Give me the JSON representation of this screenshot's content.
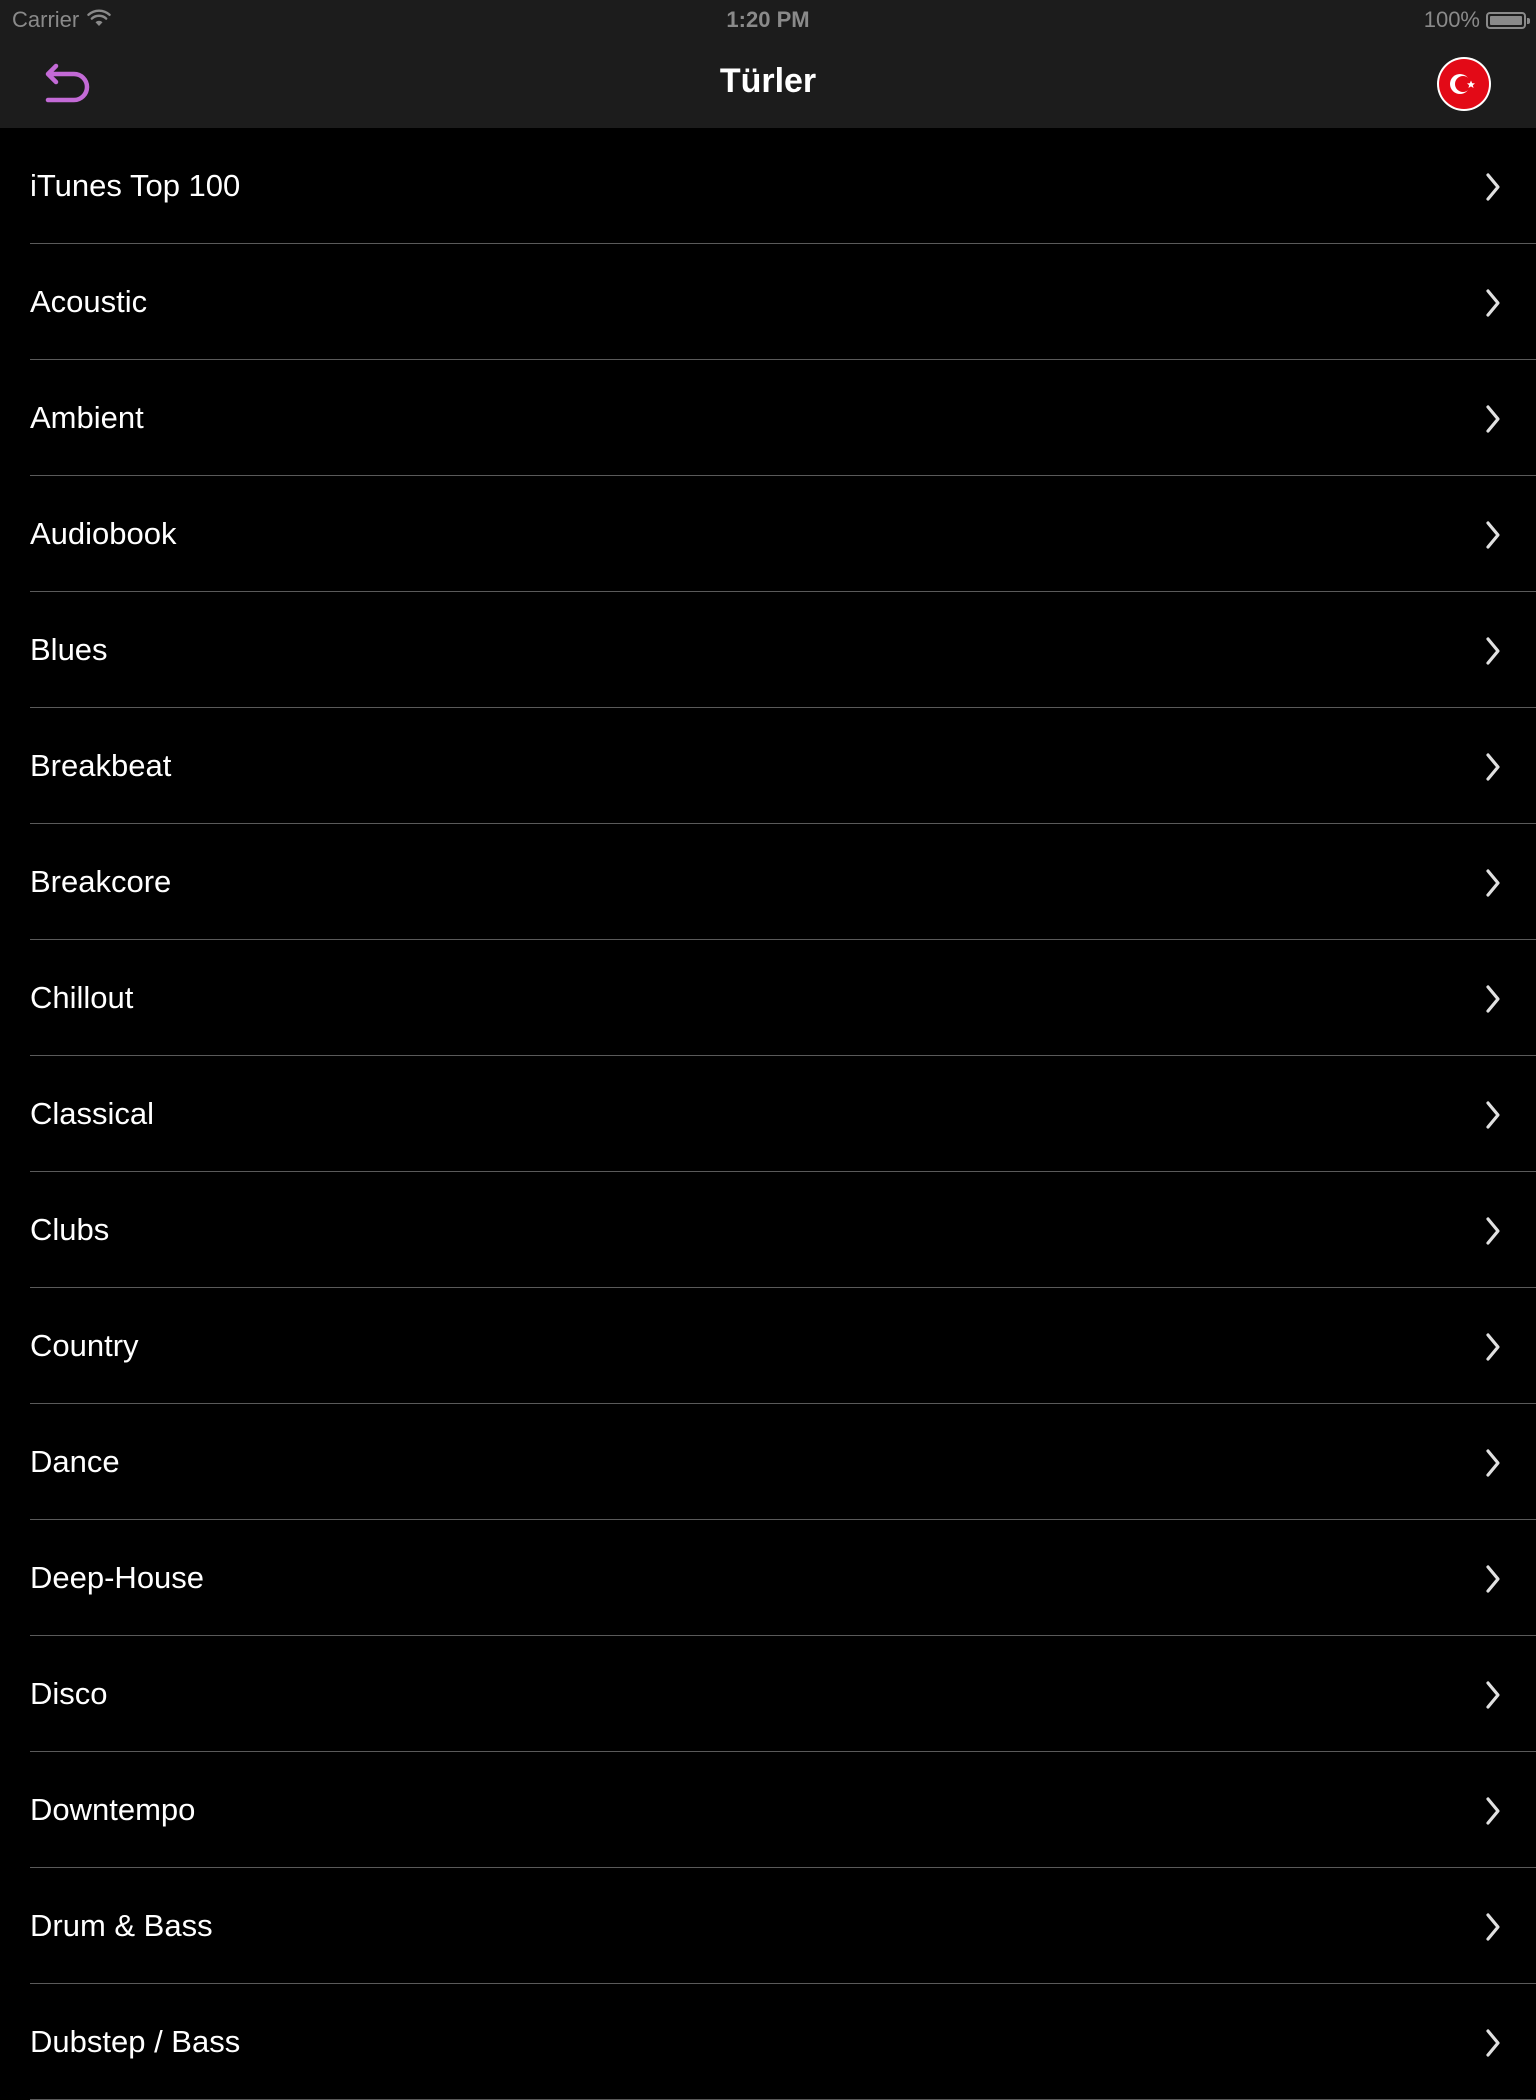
{
  "status_bar": {
    "carrier": "Carrier",
    "time": "1:20 PM",
    "battery_percent": "100%",
    "battery_level": 1.0,
    "icons": [
      "wifi-icon",
      "battery-icon"
    ]
  },
  "nav_bar": {
    "title": "Türler",
    "back_icon": "back-arrow-icon",
    "back_icon_color": "#c36ad6",
    "flag_icon": "turkey-flag-icon",
    "flag_color": "#e30a17"
  },
  "genres": [
    {
      "label": "iTunes Top 100"
    },
    {
      "label": "Acoustic"
    },
    {
      "label": "Ambient"
    },
    {
      "label": "Audiobook"
    },
    {
      "label": "Blues"
    },
    {
      "label": "Breakbeat"
    },
    {
      "label": "Breakcore"
    },
    {
      "label": "Chillout"
    },
    {
      "label": "Classical"
    },
    {
      "label": "Clubs"
    },
    {
      "label": "Country"
    },
    {
      "label": "Dance"
    },
    {
      "label": "Deep-House"
    },
    {
      "label": "Disco"
    },
    {
      "label": "Downtempo"
    },
    {
      "label": "Drum & Bass"
    },
    {
      "label": "Dubstep / Bass"
    }
  ],
  "colors": {
    "background": "#000000",
    "bar_background": "#1c1c1c",
    "separator": "#5a5a5a",
    "text": "#ffffff",
    "status_text": "#8a8a8a"
  }
}
